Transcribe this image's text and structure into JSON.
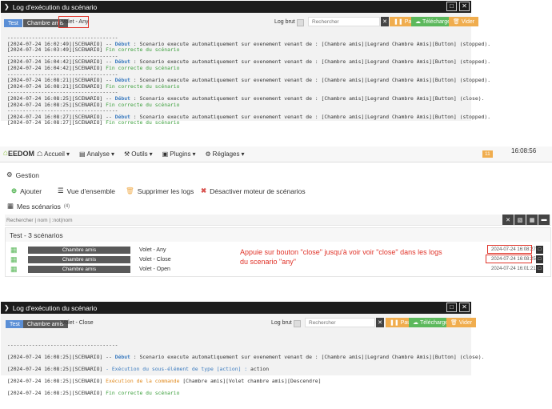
{
  "log1": {
    "title": "Log d'exécution du scénario",
    "tabs": [
      "Test",
      "Chambre amis",
      "Volet - Any"
    ],
    "log_brut_label": "Log brut",
    "search_placeholder": "Rechercher",
    "btn_pause": "Pause",
    "btn_download": "Télécharger",
    "btn_clear": "Vider",
    "sep": "------------------------------------",
    "lines": [
      {
        "ts": "[2024-07-24 16:02:49][SCENARIO]",
        "mid": " -- ",
        "kw": "Début",
        "rest": " : Scenario execute automatiquement sur evenement venant de : [Chambre amis][Legrand Chambre Amis][Button] (stopped)."
      },
      {
        "ts": "[2024-07-24 16:03:49][SCENARIO]",
        "fin": " Fin correcte du scénario"
      },
      {
        "ts": "[2024-07-24 16:04:42][SCENARIO]",
        "mid": " -- ",
        "kw": "Début",
        "rest": " : Scenario execute automatiquement sur evenement venant de : [Chambre amis][Legrand Chambre Amis][Button] (stopped)."
      },
      {
        "ts": "[2024-07-24 16:04:42][SCENARIO]",
        "fin": " Fin correcte du scénario"
      },
      {
        "ts": "[2024-07-24 16:08:21][SCENARIO]",
        "mid": " -- ",
        "kw": "Début",
        "rest": " : Scenario execute automatiquement sur evenement venant de : [Chambre amis][Legrand Chambre Amis][Button] (stopped)."
      },
      {
        "ts": "[2024-07-24 16:08:21][SCENARIO]",
        "fin": " Fin correcte du scénario"
      },
      {
        "ts": "[2024-07-24 16:08:25][SCENARIO]",
        "mid": " -- ",
        "kw": "Début",
        "rest": " : Scenario execute automatiquement sur evenement venant de : [Chambre amis][Legrand Chambre Amis][Button] (close)."
      },
      {
        "ts": "[2024-07-24 16:08:25][SCENARIO]",
        "fin": " Fin correcte du scénario"
      },
      {
        "ts": "[2024-07-24 16:08:27][SCENARIO]",
        "mid": " -- ",
        "kw": "Début",
        "rest": " : Scenario execute automatiquement sur evenement venant de : [Chambre amis][Legrand Chambre Amis][Button] (stopped)."
      },
      {
        "ts": "[2024-07-24 16:08:27][SCENARIO]",
        "fin": " Fin correcte du scénario"
      }
    ]
  },
  "nav": {
    "logo": "EEDOM",
    "items": [
      "Accueil",
      "Analyse",
      "Outils",
      "Plugins",
      "Réglages"
    ],
    "badge": "11",
    "time": "16:08:56"
  },
  "gestion": {
    "title": "Gestion",
    "add": "Ajouter",
    "overview": "Vue d'ensemble",
    "delete_logs": "Supprimer les logs",
    "disable_engine": "Désactiver moteur de scénarios"
  },
  "scenarios": {
    "title": "Mes scénarios",
    "count": "(4)",
    "search_placeholder": "Rechercher | nom | :not(nom",
    "group": "Test - 3 scénarios",
    "rows": [
      {
        "object": "Chambre amis",
        "name": "Volet - Any",
        "date": "2024-07-24 16:08:27"
      },
      {
        "object": "Chambre amis",
        "name": "Volet - Close",
        "date": "2024-07-24 16:08:25"
      },
      {
        "object": "Chambre amis",
        "name": "Volet - Open",
        "date": "2024-07-24 16:01:21"
      }
    ]
  },
  "annotation": {
    "line1": "Appuie sur bouton \"close\"  jusqu'à voir voir \"close\" dans les logs",
    "line2": "du scenario \"any\""
  },
  "log2": {
    "title": "Log d'exécution du scénario",
    "tabs": [
      "Test",
      "Chambre amis",
      "Volet - Close"
    ],
    "log_brut_label": "Log brut",
    "search_placeholder": "Rechercher",
    "btn_pause": "Pause",
    "btn_download": "Télécharger",
    "btn_clear": "Vider",
    "sep": "------------------------------------",
    "l1_ts": "[2024-07-24 16:08:25][SCENARIO]",
    "l1_kw": "Début",
    "l1_rest": " : Scenario execute automatiquement sur evenement venant de : [Chambre amis][Legrand Chambre Amis][Button] (close).",
    "l2_ts": "[2024-07-24 16:08:25][SCENARIO]",
    "l2_text": " - Exécution du sous-élément de type [action] :",
    "l2_rest": " action",
    "l3_ts": "[2024-07-24 16:08:25][SCENARIO]",
    "l3_text": " Exécution de la commande",
    "l3_rest": " [Chambre amis][Volet chambre amis][Descendre]",
    "l4_ts": "[2024-07-24 16:08:25][SCENARIO]",
    "l4_fin": " Fin correcte du scénario"
  },
  "colors": {
    "accent_red": "#e0342a",
    "green": "#5cb85c",
    "orange": "#f0ad4e",
    "blue": "#5b8fd6"
  }
}
